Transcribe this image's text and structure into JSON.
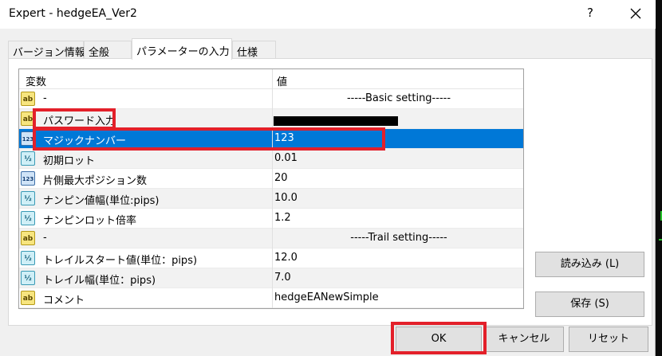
{
  "window": {
    "title": "Expert - hedgeEA_Ver2",
    "help_glyph": "?"
  },
  "tabs": [
    {
      "label": "バージョン情報",
      "active": false
    },
    {
      "label": "全般",
      "active": false
    },
    {
      "label": "パラメーターの入力",
      "active": true
    },
    {
      "label": "仕様",
      "active": false
    }
  ],
  "grid": {
    "col_variable": "変数",
    "col_value": "値",
    "rows": [
      {
        "icon": "ab-string-icon",
        "name": "-",
        "value": "-----Basic setting-----"
      },
      {
        "icon": "ab-string-icon",
        "name": "パスワード入力",
        "value": ""
      },
      {
        "icon": "integer-123-icon",
        "name": "マジックナンバー",
        "value": "123"
      },
      {
        "icon": "double-half-icon",
        "name": "初期ロット",
        "value": "0.01"
      },
      {
        "icon": "integer-123-icon",
        "name": "片側最大ポジション数",
        "value": "20"
      },
      {
        "icon": "double-half-icon",
        "name": "ナンピン値幅(単位:pips)",
        "value": "10.0"
      },
      {
        "icon": "double-half-icon",
        "name": "ナンピンロット倍率",
        "value": "1.2"
      },
      {
        "icon": "ab-string-icon",
        "name": "-",
        "value": "-----Trail setting-----"
      },
      {
        "icon": "double-half-icon",
        "name": "トレイルスタート値(単位：pips)",
        "value": "12.0"
      },
      {
        "icon": "double-half-icon",
        "name": "トレイル幅(単位：pips)",
        "value": "7.0"
      },
      {
        "icon": "ab-string-icon",
        "name": "コメント",
        "value": "hedgeEANewSimple"
      }
    ]
  },
  "buttons": {
    "load": "読み込み (L)",
    "save": "保存 (S)",
    "ok": "OK",
    "cancel": "キャンセル",
    "reset": "リセット"
  },
  "icon_glyphs": {
    "ab": "ab",
    "n123": "123",
    "half": "½"
  },
  "colors": {
    "selection": "#0078d7",
    "highlight_box": "#e3202a"
  }
}
